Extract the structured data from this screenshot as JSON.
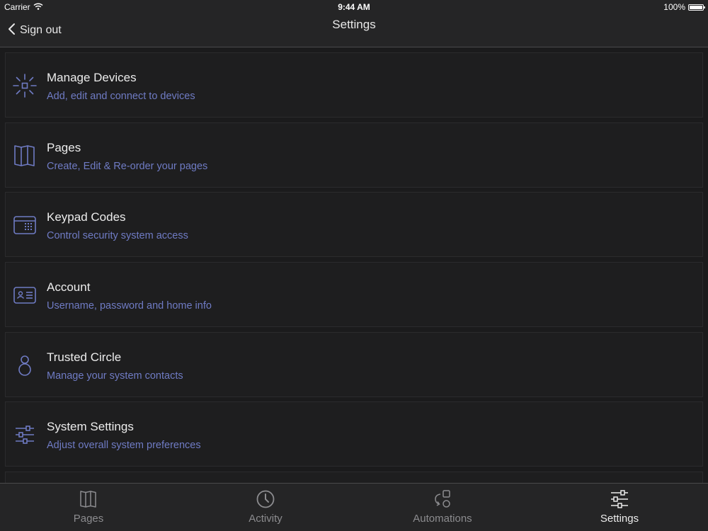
{
  "status_bar": {
    "carrier": "Carrier",
    "time": "9:44 AM",
    "battery": "100%"
  },
  "nav": {
    "back_label": "Sign out",
    "title": "Settings"
  },
  "items": [
    {
      "title": "Manage Devices",
      "subtitle": "Add, edit and connect to devices",
      "icon": "devices-icon"
    },
    {
      "title": "Pages",
      "subtitle": "Create, Edit & Re-order your pages",
      "icon": "pages-icon"
    },
    {
      "title": "Keypad Codes",
      "subtitle": "Control security system access",
      "icon": "keypad-icon"
    },
    {
      "title": "Account",
      "subtitle": "Username, password and home info",
      "icon": "account-card-icon"
    },
    {
      "title": "Trusted Circle",
      "subtitle": "Manage your system contacts",
      "icon": "person-icon"
    },
    {
      "title": "System Settings",
      "subtitle": "Adjust overall system preferences",
      "icon": "sliders-icon"
    }
  ],
  "tabs": [
    {
      "label": "Pages",
      "icon": "pages-icon",
      "active": false
    },
    {
      "label": "Activity",
      "icon": "clock-icon",
      "active": false
    },
    {
      "label": "Automations",
      "icon": "automations-icon",
      "active": false
    },
    {
      "label": "Settings",
      "icon": "sliders-icon",
      "active": true
    }
  ],
  "colors": {
    "accent": "#6f7bc4",
    "background": "#1b1b1c",
    "bar": "#252526"
  }
}
